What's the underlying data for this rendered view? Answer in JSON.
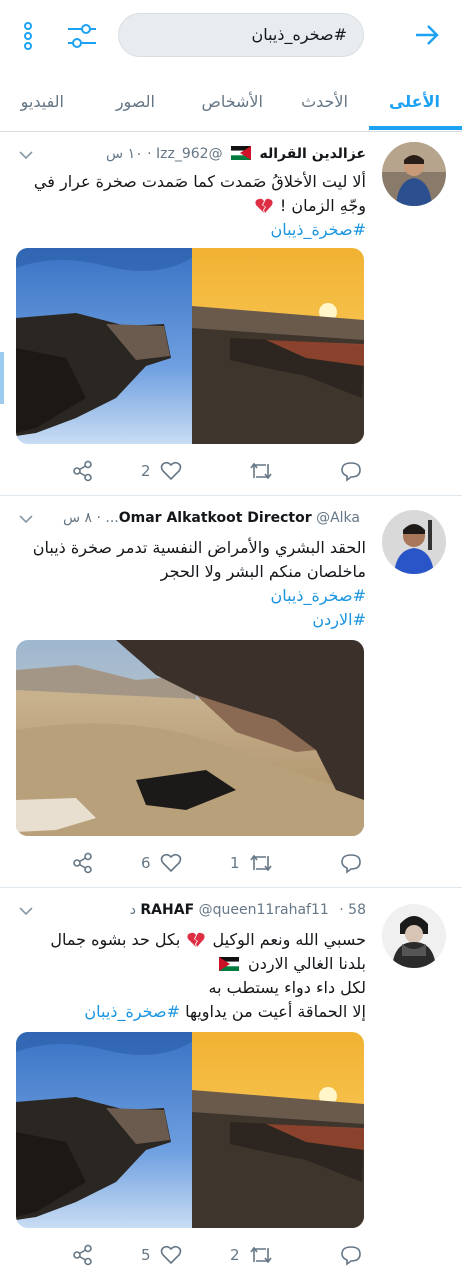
{
  "search": {
    "query": "#صخره_ذيبان"
  },
  "tabs": [
    {
      "label": "الأعلى",
      "active": true
    },
    {
      "label": "الأحدث"
    },
    {
      "label": "الأشخاص"
    },
    {
      "label": "الصور"
    },
    {
      "label": "الفيديو"
    }
  ],
  "colors": {
    "accent": "#1da1f2",
    "hashtag": "#1b95e0",
    "muted": "#657786"
  },
  "tweets": [
    {
      "name": "عزالدين القراله",
      "handle": "@Izz_962",
      "time": "١٠ س",
      "lines": [
        "ألا ليت الأخلاقُ صَمدت كما صَمدت صخرة عرار في",
        "وجّهِ الزمان !"
      ],
      "hashtags": [
        "#صخرة_ذيبان"
      ],
      "likes": "2",
      "retweets": ""
    },
    {
      "name": "Omar Alkatkoot Director",
      "handle": "@Alka...",
      "time": "٨ س",
      "lines": [
        "الحقد البشري والأمراض النفسية تدمر صخرة ذيبان",
        "ماخلصان منكم البشر ولا الحجر"
      ],
      "hashtags": [
        "#صخرة_ذيبان",
        "#الاردن"
      ],
      "likes": "6",
      "retweets": "1"
    },
    {
      "name": "RAHAF",
      "handle": "@queen11rahaf11",
      "time": "58 د",
      "lines": [
        "حسبي الله ونعم الوكيل",
        "بكل حد بشوه جمال",
        "بلدنا الغالي الاردن",
        "لكل داء دواء يستطب به",
        "إلا الحماقة أعيت من يداويها"
      ],
      "hashtags": [
        "#صخرة_ذيبان"
      ],
      "likes": "5",
      "retweets": "2"
    }
  ]
}
